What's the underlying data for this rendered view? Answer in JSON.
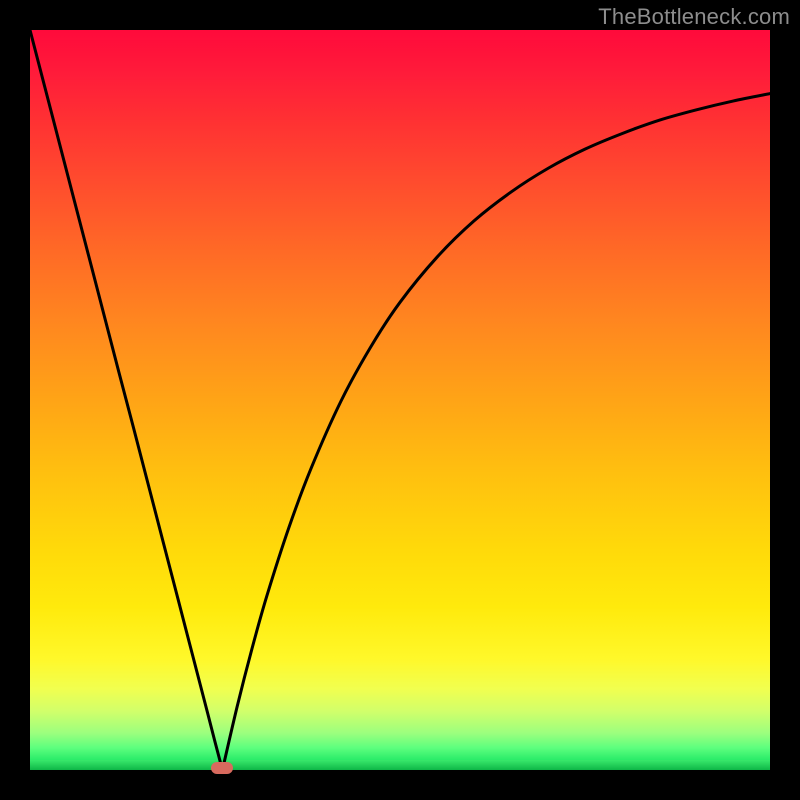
{
  "watermark": "TheBottleneck.com",
  "colors": {
    "curve": "#000000",
    "marker": "#d86a5e",
    "background_top": "#ff0a3b",
    "background_bottom": "#10c94e",
    "frame": "#000000"
  },
  "chart_data": {
    "type": "line",
    "title": "",
    "xlabel": "",
    "ylabel": "",
    "xlim": [
      0,
      100
    ],
    "ylim": [
      0,
      100
    ],
    "grid": false,
    "legend": false,
    "notch_x": 26,
    "notch_y": 0,
    "marker": {
      "x": 26,
      "y": 0
    },
    "series": [
      {
        "name": "left-branch",
        "x": [
          0,
          2,
          4,
          6,
          8,
          10,
          12,
          14,
          16,
          18,
          20,
          22,
          24,
          25,
          26
        ],
        "y": [
          100,
          92.3,
          84.6,
          76.9,
          69.2,
          61.5,
          53.8,
          46.2,
          38.5,
          30.8,
          23.1,
          15.4,
          7.7,
          3.8,
          0
        ]
      },
      {
        "name": "right-branch",
        "x": [
          26,
          28,
          30,
          32,
          35,
          38,
          42,
          46,
          50,
          55,
          60,
          65,
          70,
          75,
          80,
          85,
          90,
          95,
          100
        ],
        "y": [
          0,
          8.6,
          16.4,
          23.5,
          32.8,
          40.8,
          49.8,
          57.1,
          63.2,
          69.3,
          74.2,
          78.1,
          81.3,
          83.9,
          86.0,
          87.8,
          89.2,
          90.4,
          91.4
        ]
      }
    ]
  }
}
